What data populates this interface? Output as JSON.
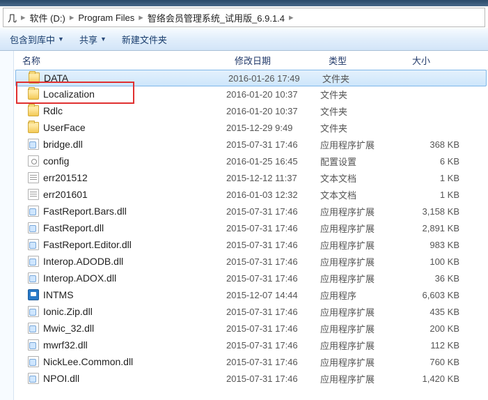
{
  "breadcrumbs": [
    "软件 (D:)",
    "Program Files",
    "智络会员管理系统_试用版_6.9.1.4"
  ],
  "toolbar": {
    "include": "包含到库中",
    "share": "共享",
    "newfolder": "新建文件夹"
  },
  "columns": {
    "name": "名称",
    "date": "修改日期",
    "type": "类型",
    "size": "大小"
  },
  "files": [
    {
      "icon": "folder",
      "name": "DATA",
      "date": "2016-01-26 17:49",
      "type": "文件夹",
      "size": "",
      "selected": true
    },
    {
      "icon": "folder",
      "name": "Localization",
      "date": "2016-01-20 10:37",
      "type": "文件夹",
      "size": ""
    },
    {
      "icon": "folder",
      "name": "Rdlc",
      "date": "2016-01-20 10:37",
      "type": "文件夹",
      "size": ""
    },
    {
      "icon": "folder",
      "name": "UserFace",
      "date": "2015-12-29 9:49",
      "type": "文件夹",
      "size": ""
    },
    {
      "icon": "dll",
      "name": "bridge.dll",
      "date": "2015-07-31 17:46",
      "type": "应用程序扩展",
      "size": "368 KB"
    },
    {
      "icon": "cfg",
      "name": "config",
      "date": "2016-01-25 16:45",
      "type": "配置设置",
      "size": "6 KB"
    },
    {
      "icon": "txt",
      "name": "err201512",
      "date": "2015-12-12 11:37",
      "type": "文本文档",
      "size": "1 KB"
    },
    {
      "icon": "txt",
      "name": "err201601",
      "date": "2016-01-03 12:32",
      "type": "文本文档",
      "size": "1 KB"
    },
    {
      "icon": "dll",
      "name": "FastReport.Bars.dll",
      "date": "2015-07-31 17:46",
      "type": "应用程序扩展",
      "size": "3,158 KB"
    },
    {
      "icon": "dll",
      "name": "FastReport.dll",
      "date": "2015-07-31 17:46",
      "type": "应用程序扩展",
      "size": "2,891 KB"
    },
    {
      "icon": "dll",
      "name": "FastReport.Editor.dll",
      "date": "2015-07-31 17:46",
      "type": "应用程序扩展",
      "size": "983 KB"
    },
    {
      "icon": "dll",
      "name": "Interop.ADODB.dll",
      "date": "2015-07-31 17:46",
      "type": "应用程序扩展",
      "size": "100 KB"
    },
    {
      "icon": "dll",
      "name": "Interop.ADOX.dll",
      "date": "2015-07-31 17:46",
      "type": "应用程序扩展",
      "size": "36 KB"
    },
    {
      "icon": "exe",
      "name": "INTMS",
      "date": "2015-12-07 14:44",
      "type": "应用程序",
      "size": "6,603 KB"
    },
    {
      "icon": "dll",
      "name": "Ionic.Zip.dll",
      "date": "2015-07-31 17:46",
      "type": "应用程序扩展",
      "size": "435 KB"
    },
    {
      "icon": "dll",
      "name": "Mwic_32.dll",
      "date": "2015-07-31 17:46",
      "type": "应用程序扩展",
      "size": "200 KB"
    },
    {
      "icon": "dll",
      "name": "mwrf32.dll",
      "date": "2015-07-31 17:46",
      "type": "应用程序扩展",
      "size": "112 KB"
    },
    {
      "icon": "dll",
      "name": "NickLee.Common.dll",
      "date": "2015-07-31 17:46",
      "type": "应用程序扩展",
      "size": "760 KB"
    },
    {
      "icon": "dll",
      "name": "NPOI.dll",
      "date": "2015-07-31 17:46",
      "type": "应用程序扩展",
      "size": "1,420 KB"
    }
  ]
}
